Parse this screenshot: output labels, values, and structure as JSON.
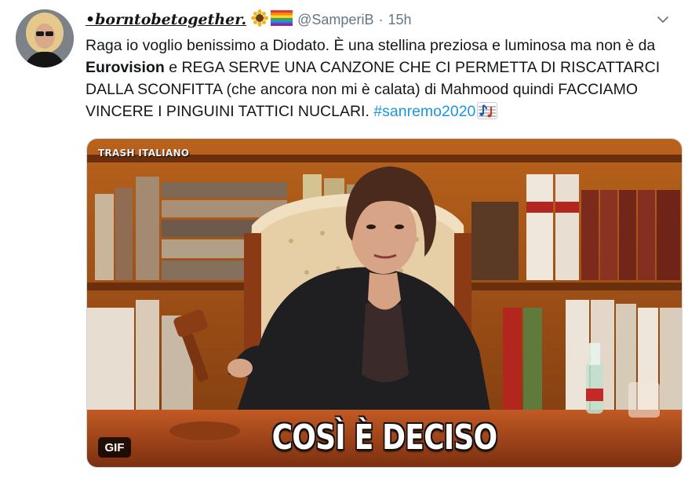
{
  "tweet": {
    "display_name": "•borntobetogether.",
    "name_emojis": [
      "sunflower-emoji",
      "rainbow-flag-emoji"
    ],
    "handle": "@SamperiB",
    "separator": "·",
    "time": "15h",
    "text_part1": "Raga io voglio benissimo a Diodato. È una stellina preziosa e luminosa ma non è da ",
    "text_bold": "Eurovision",
    "text_part2": " e REGA SERVE UNA CANZONE CHE CI PERMETTA DI RISCATTARCI DALLA SCONFITTA (che ancora non mi è calata) di Mahmood quindi FACCIAMO VINCERE I PINGUINI TATTICI NUCLARI. ",
    "hashtag": "#sanremo2020",
    "trailing_emoji": "musical-score-emoji"
  },
  "media": {
    "watermark": "TRASH ITALIANO",
    "caption": "COSÌ È DECISO",
    "badge": "GIF"
  },
  "colors": {
    "link": "#1b95e0",
    "muted": "#657786",
    "text": "#14171a"
  }
}
